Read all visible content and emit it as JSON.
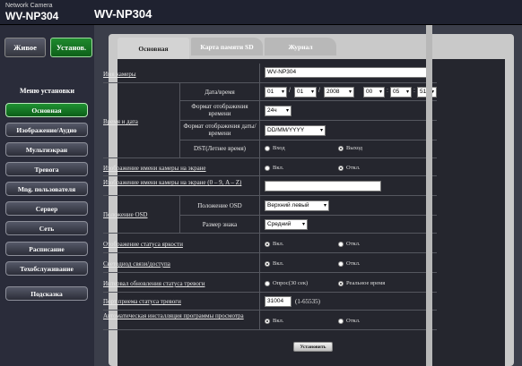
{
  "header": {
    "brand_small": "Network Camera",
    "brand_big": "WV-NP304",
    "model": "WV-NP304"
  },
  "top_tabs": {
    "live": "Живое",
    "setup": "Установ."
  },
  "menu": {
    "header": "Меню установки",
    "items": [
      "Основная",
      "Изображение/Аудио",
      "Мультиэкран",
      "Тревога",
      "Mng. пользователя",
      "Сервер",
      "Сеть",
      "Расписание",
      "Техобслуживание",
      "Подсказка"
    ]
  },
  "tabs": [
    "Основная",
    "Карта памяти SD",
    "Журнал"
  ],
  "form": {
    "camera_name_label": "Имя камеры",
    "camera_name_value": "WV-NP304",
    "time_date_label": "Время и дата",
    "datetime_label": "Дата/время",
    "date_month": "01",
    "date_day": "01",
    "date_year": "2008",
    "time_h": "00",
    "time_m": "05",
    "time_s": "51",
    "time_format_label": "Формат отображения времени",
    "time_format_value": "24ч",
    "date_format_label": "Формат отображения даты/времени",
    "date_format_value": "DD/MM/YYYY",
    "dst_label": "DST(Летнее время)",
    "dst_in": "Вход",
    "dst_out": "Выход",
    "title_disp_label": "Изображение имени камеры на экране",
    "on": "Вкл.",
    "off": "Откл.",
    "title_input_label": "Изображение имени камеры на экране (0 – 9, A – Z)",
    "osd_label": "Положение OSD",
    "osd_pos_label": "Положение OSD",
    "osd_pos_value": "Верхний левый",
    "char_size_label": "Размер знака",
    "char_size_value": "Средний",
    "brightness_label": "Отображение статуса яркости",
    "led_label": "Светодиод связи/доступа",
    "alarm_interval_label": "Интервал обновления статуса тревоги",
    "alarm_poll": "Опрос(30 сек)",
    "alarm_realtime": "Реальное время",
    "alarm_port_label": "Порт приема статуса тревоги",
    "alarm_port_value": "31004",
    "alarm_port_range": "(1-65535)",
    "viewer_label": "Автоматическая инсталляция программы просмотра",
    "set_button": "Установить"
  }
}
